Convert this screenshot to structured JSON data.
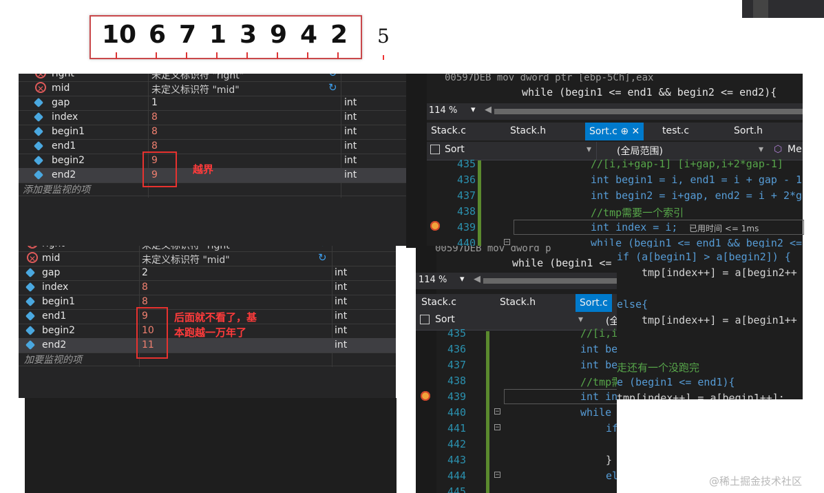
{
  "top_numbers": [
    "10",
    "6",
    "7",
    "1",
    "3",
    "9",
    "4",
    "2"
  ],
  "extra_number": "5",
  "watch1": {
    "rows": [
      {
        "icon": "error",
        "name": "right",
        "value": "未定义标识符 \"right\"",
        "type": ""
      },
      {
        "icon": "error",
        "name": "mid",
        "value": "未定义标识符 \"mid\"",
        "type": ""
      },
      {
        "icon": "var",
        "name": "gap",
        "value": "1",
        "type": "int"
      },
      {
        "icon": "var",
        "name": "index",
        "value": "8",
        "type": "int"
      },
      {
        "icon": "var",
        "name": "begin1",
        "value": "8",
        "type": "int"
      },
      {
        "icon": "var",
        "name": "end1",
        "value": "8",
        "type": "int"
      },
      {
        "icon": "var",
        "name": "begin2",
        "value": "9",
        "type": "int"
      },
      {
        "icon": "var",
        "name": "end2",
        "value": "9",
        "type": "int"
      }
    ],
    "add_placeholder": "添加要监视的项",
    "annotation": "越界"
  },
  "watch2": {
    "rows": [
      {
        "icon": "error",
        "name": "right",
        "value": "未定义标识符 \"right\"",
        "type": ""
      },
      {
        "icon": "error",
        "name": "mid",
        "value": "未定义标识符 \"mid\"",
        "type": ""
      },
      {
        "icon": "var",
        "name": "gap",
        "value": "2",
        "type": "int"
      },
      {
        "icon": "var",
        "name": "index",
        "value": "8",
        "type": "int"
      },
      {
        "icon": "var",
        "name": "begin1",
        "value": "8",
        "type": "int"
      },
      {
        "icon": "var",
        "name": "end1",
        "value": "9",
        "type": "int"
      },
      {
        "icon": "var",
        "name": "begin2",
        "value": "10",
        "type": "int"
      },
      {
        "icon": "var",
        "name": "end2",
        "value": "11",
        "type": "int"
      }
    ],
    "add_placeholder": "加要监视的项",
    "annotation_line1": "后面就不看了，基",
    "annotation_line2": "本跑越一万年了"
  },
  "code1": {
    "disasm": "00597DEB  mov         dword ptr [ebp-5Ch],eax",
    "while_header": "while (begin1 <= end1 && begin2 <= end2){",
    "zoom": "114 %",
    "tabs": [
      "Stack.c",
      "Stack.h",
      "Sort.c",
      "test.c",
      "Sort.h"
    ],
    "active_tab": "Sort.c",
    "nav_left": "Sort",
    "nav_mid": "(全局范围)",
    "nav_right": "Me",
    "lines": [
      {
        "n": "435",
        "text": "//[i,i+gap-1]  [i+gap,i+2*gap-1]"
      },
      {
        "n": "436",
        "text": "int begin1 = i, end1 = i + gap - 1"
      },
      {
        "n": "437",
        "text": "int begin2 = i+gap, end2 = i + 2*g"
      },
      {
        "n": "438",
        "text": "//tmp需要一个索引"
      },
      {
        "n": "439",
        "text": "int index = i;",
        "hint": "已用时间 <= 1ms"
      },
      {
        "n": "440",
        "text": "while (begin1 <= end1 && begin2 <="
      }
    ]
  },
  "code2": {
    "disasm": "00597DEB  mov         dword p",
    "while_header": "while (begin1 <=",
    "zoom": "114 %",
    "tabs": [
      "Stack.c",
      "Stack.h",
      "Sort.c"
    ],
    "active_tab": "Sort.c",
    "nav_left": "Sort",
    "nav_mid": "(全",
    "line_numbers": [
      "435",
      "436",
      "437",
      "438",
      "439",
      "440",
      "441",
      "442",
      "443",
      "444",
      "445"
    ],
    "frag": [
      "//[i,i",
      "int be",
      "int be",
      "//tmp需",
      "int in",
      "while",
      "if",
      "",
      "}",
      "el",
      ""
    ]
  },
  "code3": {
    "lines": [
      "if (a[begin1] > a[begin2]) {",
      "tmp[index++] = a[begin2++",
      "",
      "else{",
      "tmp[index++] = a[begin1++",
      "",
      "走还有一个没跑完",
      "e (begin1 <= end1){",
      "tmp[index++] = a[begin1++];"
    ]
  },
  "watermark": "@稀土掘金技术社区"
}
